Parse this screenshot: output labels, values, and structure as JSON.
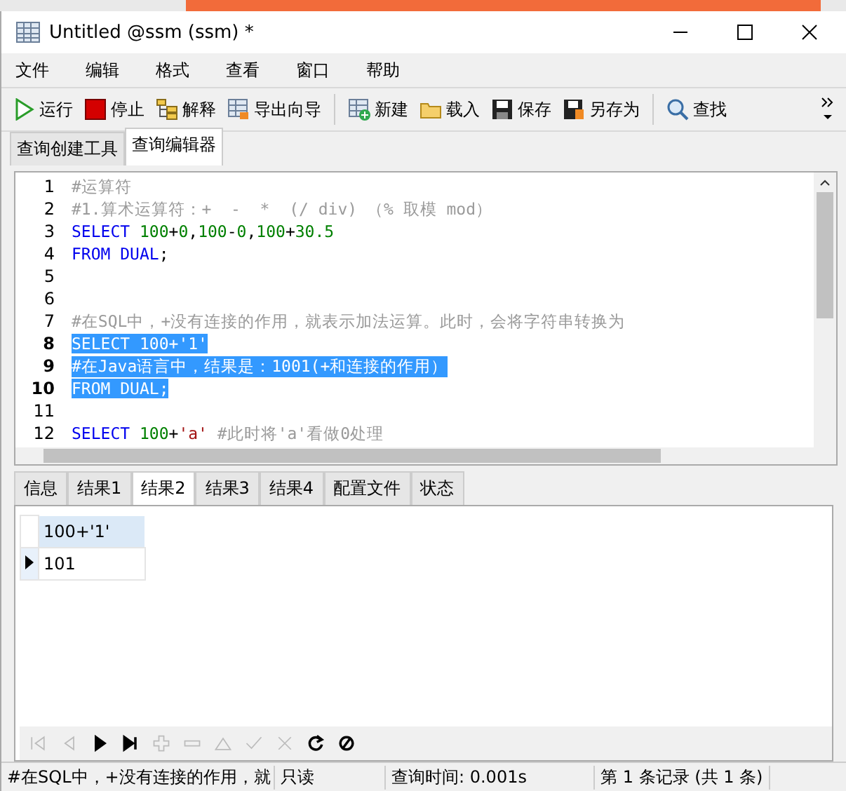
{
  "window": {
    "title": "Untitled @ssm (ssm) *"
  },
  "menu": [
    "文件",
    "编辑",
    "格式",
    "查看",
    "窗口",
    "帮助"
  ],
  "toolbar": [
    {
      "kind": "run",
      "label": "运行"
    },
    {
      "kind": "stop",
      "label": "停止"
    },
    {
      "kind": "explain",
      "label": "解释"
    },
    {
      "kind": "export",
      "label": "导出向导"
    },
    {
      "kind": "new",
      "label": "新建"
    },
    {
      "kind": "load",
      "label": "载入"
    },
    {
      "kind": "save",
      "label": "保存"
    },
    {
      "kind": "saveas",
      "label": "另存为"
    },
    {
      "kind": "find",
      "label": "查找"
    }
  ],
  "editor_tabs": [
    {
      "label": "查询创建工具",
      "selected": false
    },
    {
      "label": "查询编辑器",
      "selected": true
    }
  ],
  "code": [
    {
      "n": "1",
      "selected": false,
      "tokens": [
        {
          "kind": "comment",
          "text": "#运算符"
        }
      ]
    },
    {
      "n": "2",
      "selected": false,
      "tokens": [
        {
          "kind": "comment",
          "text": "#1.算术运算符：+  -  *  (/ div) （% 取模 mod）"
        }
      ]
    },
    {
      "n": "3",
      "selected": false,
      "tokens": [
        {
          "kind": "keyword",
          "text": "SELECT "
        },
        {
          "kind": "number",
          "text": "100"
        },
        {
          "kind": "plain",
          "text": "+"
        },
        {
          "kind": "number",
          "text": "0"
        },
        {
          "kind": "plain",
          "text": ","
        },
        {
          "kind": "number",
          "text": "100"
        },
        {
          "kind": "plain",
          "text": "-"
        },
        {
          "kind": "number",
          "text": "0"
        },
        {
          "kind": "plain",
          "text": ","
        },
        {
          "kind": "number",
          "text": "100"
        },
        {
          "kind": "plain",
          "text": "+"
        },
        {
          "kind": "number",
          "text": "30.5"
        }
      ]
    },
    {
      "n": "4",
      "selected": false,
      "tokens": [
        {
          "kind": "keyword",
          "text": "FROM DUAL"
        },
        {
          "kind": "plain",
          "text": ";"
        }
      ]
    },
    {
      "n": "5",
      "selected": false
    },
    {
      "n": "6",
      "selected": false
    },
    {
      "n": "7",
      "selected": false,
      "tokens": [
        {
          "kind": "comment",
          "text": "#在SQL中，+没有连接的作用，就表示加法运算。此时，会将字符串转换为"
        }
      ]
    },
    {
      "n": "8",
      "selected": true,
      "tokens": [
        {
          "kind": "keyword",
          "text": "SELECT "
        },
        {
          "kind": "number",
          "text": "100"
        },
        {
          "kind": "plain",
          "text": "+"
        },
        {
          "kind": "string",
          "text": "'1'"
        }
      ]
    },
    {
      "n": "9",
      "selected": true,
      "tokens": [
        {
          "kind": "comment",
          "text": "#在Java语言中，结果是：1001(+和连接的作用）"
        }
      ]
    },
    {
      "n": "10",
      "selected": true,
      "tokens": [
        {
          "kind": "keyword",
          "text": "FROM DUAL"
        },
        {
          "kind": "plain",
          "text": ";"
        }
      ]
    },
    {
      "n": "11",
      "selected": false
    },
    {
      "n": "12",
      "selected": false,
      "tokens": [
        {
          "kind": "keyword",
          "text": "SELECT "
        },
        {
          "kind": "number",
          "text": "100"
        },
        {
          "kind": "plain",
          "text": "+"
        },
        {
          "kind": "string",
          "text": "'a'"
        },
        {
          "kind": "comment",
          "text": " #此时将'a'看做0处理"
        }
      ]
    }
  ],
  "result_tabs": [
    {
      "label": "信息",
      "selected": false
    },
    {
      "label": "结果1",
      "selected": false
    },
    {
      "label": "结果2",
      "selected": true
    },
    {
      "label": "结果3",
      "selected": false
    },
    {
      "label": "结果4",
      "selected": false
    },
    {
      "label": "配置文件",
      "selected": false
    },
    {
      "label": "状态",
      "selected": false
    }
  ],
  "grid": {
    "columns": [
      "100+'1'"
    ],
    "rows": [
      {
        "cells": [
          "101"
        ],
        "current": true
      }
    ]
  },
  "nav": [
    {
      "kind": "first",
      "disabled": true
    },
    {
      "kind": "prev",
      "disabled": true
    },
    {
      "kind": "next",
      "disabled": false
    },
    {
      "kind": "last",
      "disabled": false
    },
    {
      "kind": "add",
      "disabled": true
    },
    {
      "kind": "remove",
      "disabled": true
    },
    {
      "kind": "up",
      "disabled": true
    },
    {
      "kind": "apply",
      "disabled": true
    },
    {
      "kind": "cancel",
      "disabled": true
    },
    {
      "kind": "refresh",
      "disabled": false
    },
    {
      "kind": "stop",
      "disabled": false
    }
  ],
  "status_bar": [
    "#在SQL中，+没有连接的作用，就",
    "只读",
    "查询时间: 0.001s",
    "第 1 条记录 (共 1 条)"
  ]
}
